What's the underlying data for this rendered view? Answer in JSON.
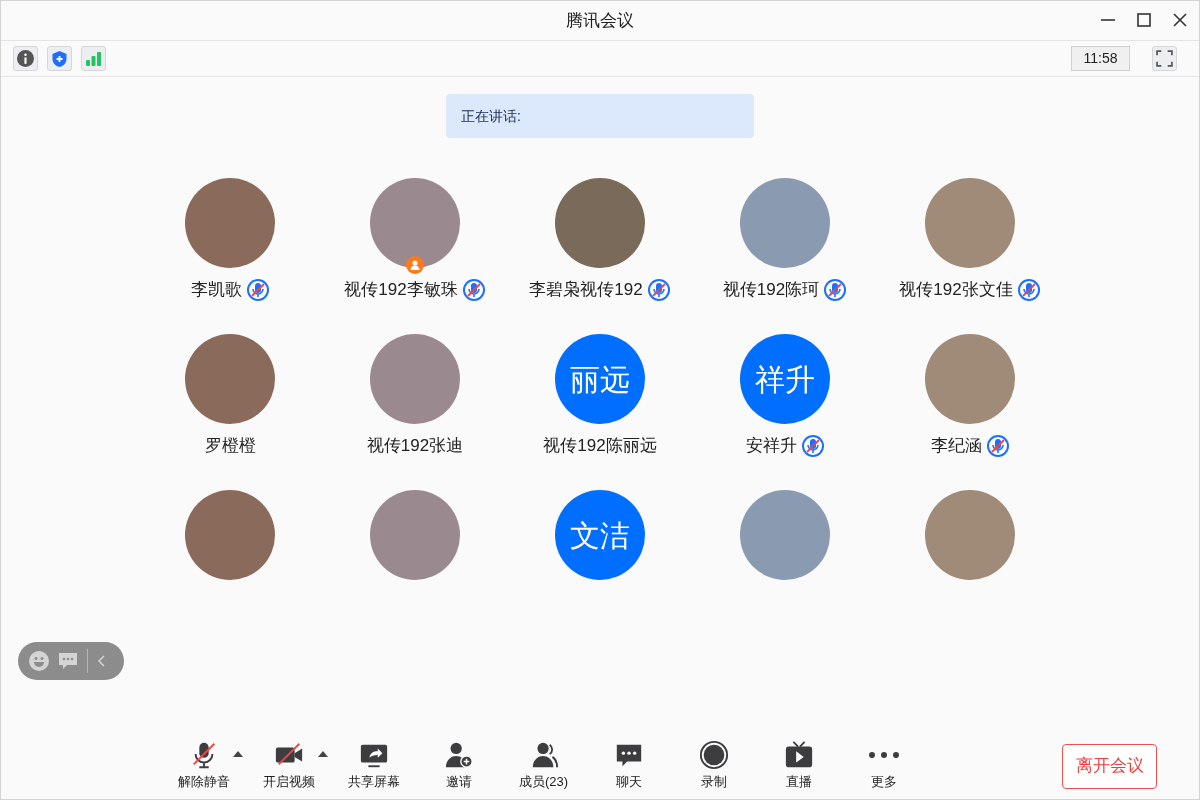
{
  "window": {
    "title": "腾讯会议"
  },
  "clock": "11:58",
  "speaking": {
    "label": "正在讲话:"
  },
  "participants": [
    {
      "kind": "photo",
      "name": "李凯歌",
      "muted": true
    },
    {
      "kind": "photo",
      "name": "视传192李敏珠",
      "muted": true,
      "host": true
    },
    {
      "kind": "photo",
      "name": "李碧枭视传192",
      "muted": true
    },
    {
      "kind": "photo",
      "name": "视传192陈珂",
      "muted": true
    },
    {
      "kind": "photo",
      "name": "视传192张文佳",
      "muted": true
    },
    {
      "kind": "photo",
      "name": "罗橙橙",
      "muted": false
    },
    {
      "kind": "photo",
      "name": "视传192张迪",
      "muted": false
    },
    {
      "kind": "text",
      "initials": "丽远",
      "name": "视传192陈丽远",
      "muted": false
    },
    {
      "kind": "text",
      "initials": "祥升",
      "name": "安祥升",
      "muted": true
    },
    {
      "kind": "photo",
      "name": "李纪涵",
      "muted": true
    },
    {
      "kind": "photo"
    },
    {
      "kind": "photo"
    },
    {
      "kind": "text",
      "initials": "文洁"
    },
    {
      "kind": "photo"
    },
    {
      "kind": "photo"
    }
  ],
  "toolbar": [
    {
      "kind": "mic",
      "label": "解除静音",
      "has_menu": true,
      "off": true
    },
    {
      "kind": "video",
      "label": "开启视频",
      "has_menu": true,
      "off": true
    },
    {
      "kind": "share",
      "label": "共享屏幕",
      "has_menu": false
    },
    {
      "kind": "invite",
      "label": "邀请",
      "has_menu": false
    },
    {
      "kind": "members",
      "label": "成员(23)",
      "has_menu": false
    },
    {
      "kind": "chat",
      "label": "聊天",
      "has_menu": false
    },
    {
      "kind": "record",
      "label": "录制",
      "has_menu": false
    },
    {
      "kind": "live",
      "label": "直播",
      "has_menu": false
    },
    {
      "kind": "more",
      "label": "更多",
      "has_menu": false
    }
  ],
  "leave_button": "离开会议"
}
